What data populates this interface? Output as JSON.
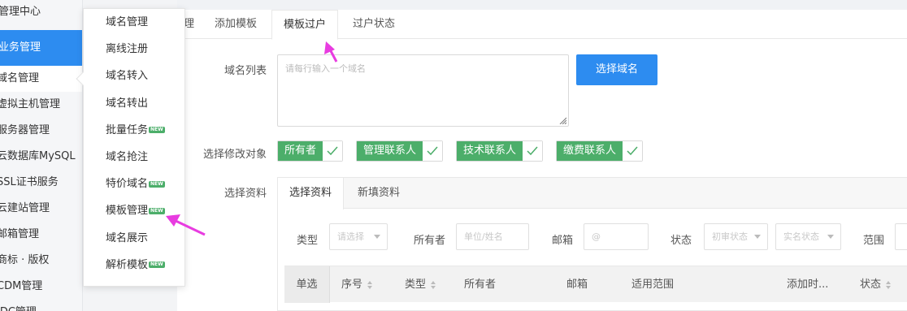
{
  "sidebar": {
    "header": "管理中心",
    "group": "业务管理",
    "items": [
      {
        "label": "域名管理",
        "active": true
      },
      {
        "label": "虚拟主机管理"
      },
      {
        "label": "服务器管理"
      },
      {
        "label": "云数据库MySQL"
      },
      {
        "label": "SSL证书服务"
      },
      {
        "label": "云建站管理"
      },
      {
        "label": "邮箱管理"
      },
      {
        "label": "商标 · 版权"
      },
      {
        "label": "CDM管理"
      },
      {
        "label": "IDC管理"
      }
    ]
  },
  "menu": {
    "items": [
      {
        "label": "域名管理",
        "new": false
      },
      {
        "label": "离线注册",
        "new": false
      },
      {
        "label": "域名转入",
        "new": false
      },
      {
        "label": "域名转出",
        "new": false
      },
      {
        "label": "批量任务",
        "new": true
      },
      {
        "label": "域名抢注",
        "new": false
      },
      {
        "label": "特价域名",
        "new": true
      },
      {
        "label": "模板管理",
        "new": true
      },
      {
        "label": "域名展示",
        "new": false
      },
      {
        "label": "解析模板",
        "new": true
      }
    ],
    "new_badge": "NEW"
  },
  "tabs": {
    "partial": "理",
    "add_template": "添加模板",
    "template_transfer": "模板过户",
    "transfer_status": "过户状态"
  },
  "form": {
    "domain_list_label": "域名列表",
    "domain_list_placeholder": "请每行输入一个域名",
    "select_domain_button": "选择域名",
    "modify_target_label": "选择修改对象",
    "targets": [
      "所有者",
      "管理联系人",
      "技术联系人",
      "缴费联系人"
    ],
    "select_profile_label": "选择资料"
  },
  "profile_panel": {
    "tabs": [
      "选择资料",
      "新填资料"
    ],
    "filters": {
      "type_label": "类型",
      "type_placeholder": "请选择",
      "owner_label": "所有者",
      "owner_placeholder": "单位/姓名",
      "email_label": "邮箱",
      "email_placeholder": "@",
      "status_label": "状态",
      "review_status_placeholder": "初审状态",
      "verify_status_placeholder": "实名状态",
      "scope_label": "范围"
    },
    "table_headers": [
      "单选",
      "序号",
      "类型",
      "所有者",
      "邮箱",
      "适用范围",
      "添加时...",
      "状态"
    ]
  },
  "colors": {
    "primary": "#2d8cf0",
    "tag_green": "#4cae6a",
    "annotation_arrow": "#e83ce0"
  }
}
